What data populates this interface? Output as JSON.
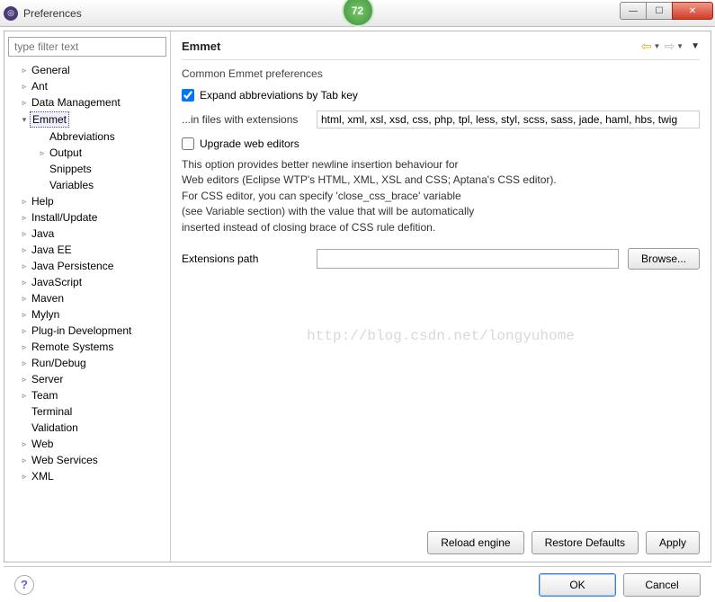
{
  "window": {
    "title": "Preferences",
    "badge": "72"
  },
  "sidebar": {
    "filter_placeholder": "type filter text",
    "items": [
      {
        "label": "General",
        "expandable": true,
        "level": 1
      },
      {
        "label": "Ant",
        "expandable": true,
        "level": 1
      },
      {
        "label": "Data Management",
        "expandable": true,
        "level": 1
      },
      {
        "label": "Emmet",
        "expandable": true,
        "level": 1,
        "expanded": true,
        "selected": true
      },
      {
        "label": "Abbreviations",
        "expandable": false,
        "level": 2
      },
      {
        "label": "Output",
        "expandable": true,
        "level": 2
      },
      {
        "label": "Snippets",
        "expandable": false,
        "level": 2
      },
      {
        "label": "Variables",
        "expandable": false,
        "level": 2
      },
      {
        "label": "Help",
        "expandable": true,
        "level": 1
      },
      {
        "label": "Install/Update",
        "expandable": true,
        "level": 1
      },
      {
        "label": "Java",
        "expandable": true,
        "level": 1
      },
      {
        "label": "Java EE",
        "expandable": true,
        "level": 1
      },
      {
        "label": "Java Persistence",
        "expandable": true,
        "level": 1
      },
      {
        "label": "JavaScript",
        "expandable": true,
        "level": 1
      },
      {
        "label": "Maven",
        "expandable": true,
        "level": 1
      },
      {
        "label": "Mylyn",
        "expandable": true,
        "level": 1
      },
      {
        "label": "Plug-in Development",
        "expandable": true,
        "level": 1
      },
      {
        "label": "Remote Systems",
        "expandable": true,
        "level": 1
      },
      {
        "label": "Run/Debug",
        "expandable": true,
        "level": 1
      },
      {
        "label": "Server",
        "expandable": true,
        "level": 1
      },
      {
        "label": "Team",
        "expandable": true,
        "level": 1
      },
      {
        "label": "Terminal",
        "expandable": false,
        "level": 1
      },
      {
        "label": "Validation",
        "expandable": false,
        "level": 1
      },
      {
        "label": "Web",
        "expandable": true,
        "level": 1
      },
      {
        "label": "Web Services",
        "expandable": true,
        "level": 1
      },
      {
        "label": "XML",
        "expandable": true,
        "level": 1
      }
    ]
  },
  "content": {
    "heading": "Emmet",
    "section_title": "Common Emmet preferences",
    "expand_cb_label": "Expand abbreviations by Tab key",
    "expand_cb_checked": true,
    "ext_label": "...in files with extensions",
    "ext_value": "html, xml, xsl, xsd, css, php, tpl, less, styl, scss, sass, jade, haml, hbs, twig",
    "upgrade_cb_label": "Upgrade web editors",
    "upgrade_cb_checked": false,
    "description_lines": [
      "This option provides better newline insertion behaviour for",
      "Web editors (Eclipse WTP's HTML, XML, XSL and CSS; Aptana's CSS editor).",
      "For CSS editor, you can specify 'close_css_brace' variable",
      "(see Variable section) with the value that will be automatically",
      "inserted instead of closing brace of CSS rule defition."
    ],
    "ext_path_label": "Extensions path",
    "ext_path_value": "",
    "browse_label": "Browse...",
    "watermark": "http://blog.csdn.net/longyuhome",
    "reload_label": "Reload engine",
    "restore_label": "Restore Defaults",
    "apply_label": "Apply"
  },
  "footer": {
    "ok_label": "OK",
    "cancel_label": "Cancel"
  }
}
